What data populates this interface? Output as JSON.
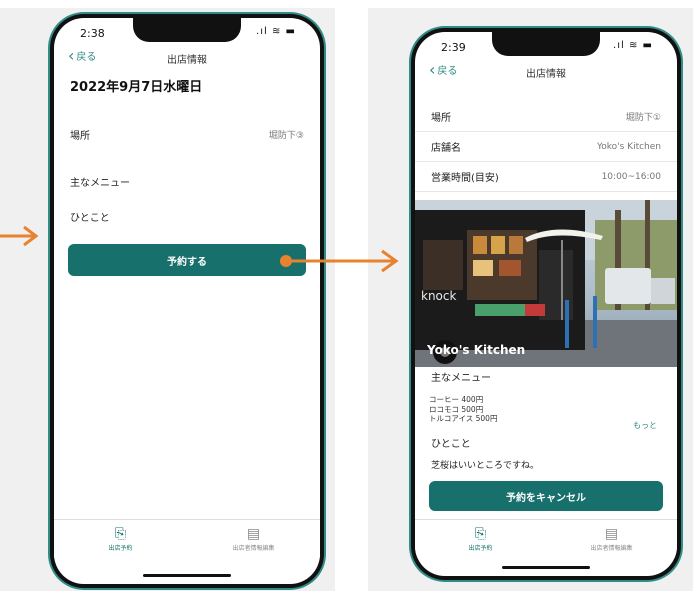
{
  "left_screen": {
    "status_time": "2:38",
    "back_label": "戻る",
    "title": "出店情報",
    "date": "2022年9月7日水曜日",
    "rows": [
      {
        "label": "場所",
        "value": "堀防下③"
      },
      {
        "label": "主なメニュー",
        "value": ""
      },
      {
        "label": "ひとこと",
        "value": ""
      }
    ],
    "reserve_button": "予約する",
    "tabs": [
      {
        "label": "出店予約",
        "icon": "reserve-icon"
      },
      {
        "label": "出店者情報編集",
        "icon": "store-icon"
      }
    ]
  },
  "right_screen": {
    "status_time": "2:39",
    "back_label": "戻る",
    "title": "出店情報",
    "rows": [
      {
        "label": "場所",
        "value": "堀防下①"
      },
      {
        "label": "店舗名",
        "value": "Yoko's Kitchen"
      },
      {
        "label": "営業時間(目安)",
        "value": "10:00~16:00"
      }
    ],
    "photo": {
      "caption": "Yoko's Kitchen",
      "truck_text": "knock"
    },
    "menu_heading": "主なメニュー",
    "menu_items": [
      "コーヒー 400円",
      "ロコモコ 500円",
      "トルコアイス 500円"
    ],
    "more_label": "もっと",
    "comment_heading": "ひとこと",
    "comment_text": "芝桜はいいところですね。",
    "cancel_button": "予約をキャンセル",
    "tabs": [
      {
        "label": "出店予約",
        "icon": "reserve-icon"
      },
      {
        "label": "出店者情報編集",
        "icon": "store-icon"
      }
    ]
  },
  "colors": {
    "accent": "#17706b",
    "arrow": "#e8822e",
    "phone_frame": "#2f8d86"
  }
}
